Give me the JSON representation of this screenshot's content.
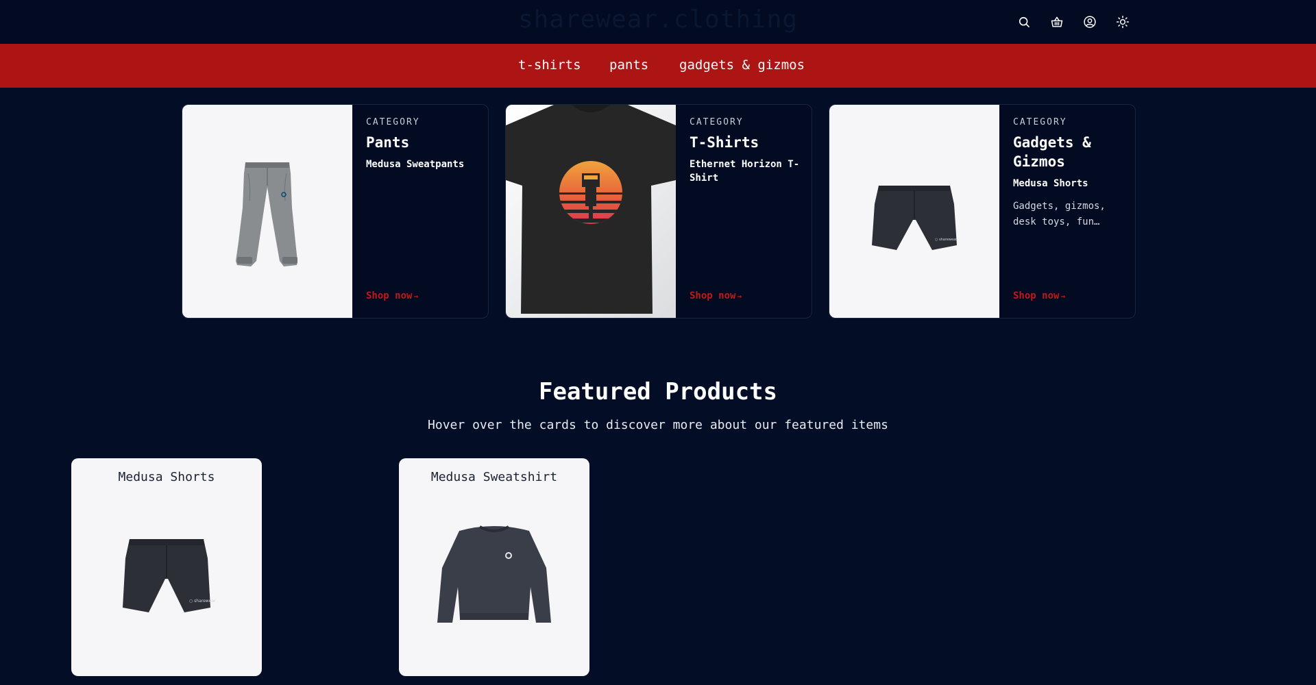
{
  "header": {
    "brand": "sharewear.clothing",
    "icons": [
      "search-icon",
      "basket-icon",
      "account-icon",
      "theme-toggle-icon"
    ]
  },
  "nav": {
    "items": [
      {
        "label": "t-shirts"
      },
      {
        "label": "pants"
      },
      {
        "label": "gadgets & gizmos"
      }
    ]
  },
  "categories": [
    {
      "kicker": "CATEGORY",
      "title": "Pants",
      "product": "Medusa Sweatpants",
      "description": "",
      "cta": "Shop now",
      "cta_arrow": "→"
    },
    {
      "kicker": "CATEGORY",
      "title": "T-Shirts",
      "product": "Ethernet Horizon T-Shirt",
      "description": "",
      "cta": "Shop now",
      "cta_arrow": "→"
    },
    {
      "kicker": "CATEGORY",
      "title": "Gadgets & Gizmos",
      "product": "Medusa Shorts",
      "description": "Gadgets, gizmos, desk toys, fun…",
      "cta": "Shop now",
      "cta_arrow": "→"
    }
  ],
  "featured": {
    "title": "Featured Products",
    "subtitle": "Hover over the cards to discover more about our featured items",
    "products": [
      {
        "name": "Medusa Shorts"
      },
      {
        "name": "Medusa Sweatshirt"
      }
    ]
  },
  "colors": {
    "background": "#030d26",
    "nav_bar": "#ad1515",
    "accent_link": "#c41717",
    "card_light": "#f6f6f8"
  }
}
